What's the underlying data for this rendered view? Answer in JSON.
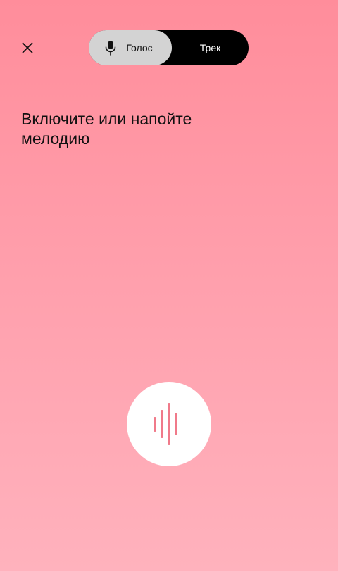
{
  "header": {
    "close_icon": "close-icon",
    "mode_tabs": [
      {
        "label": "Голос",
        "icon": "microphone-icon",
        "selected": true
      },
      {
        "label": "Трек",
        "selected": false
      }
    ]
  },
  "main": {
    "prompt_text": "Включите или напойте мелодию"
  },
  "listen_button": {
    "icon": "sound-wave-icon",
    "accent_color": "#f07a8a"
  },
  "colors": {
    "background_top": "#ff8d9b",
    "background_bottom": "#ffb2bd",
    "toggle_bg": "#000000",
    "toggle_selected_bg": "#d3d3d3"
  }
}
